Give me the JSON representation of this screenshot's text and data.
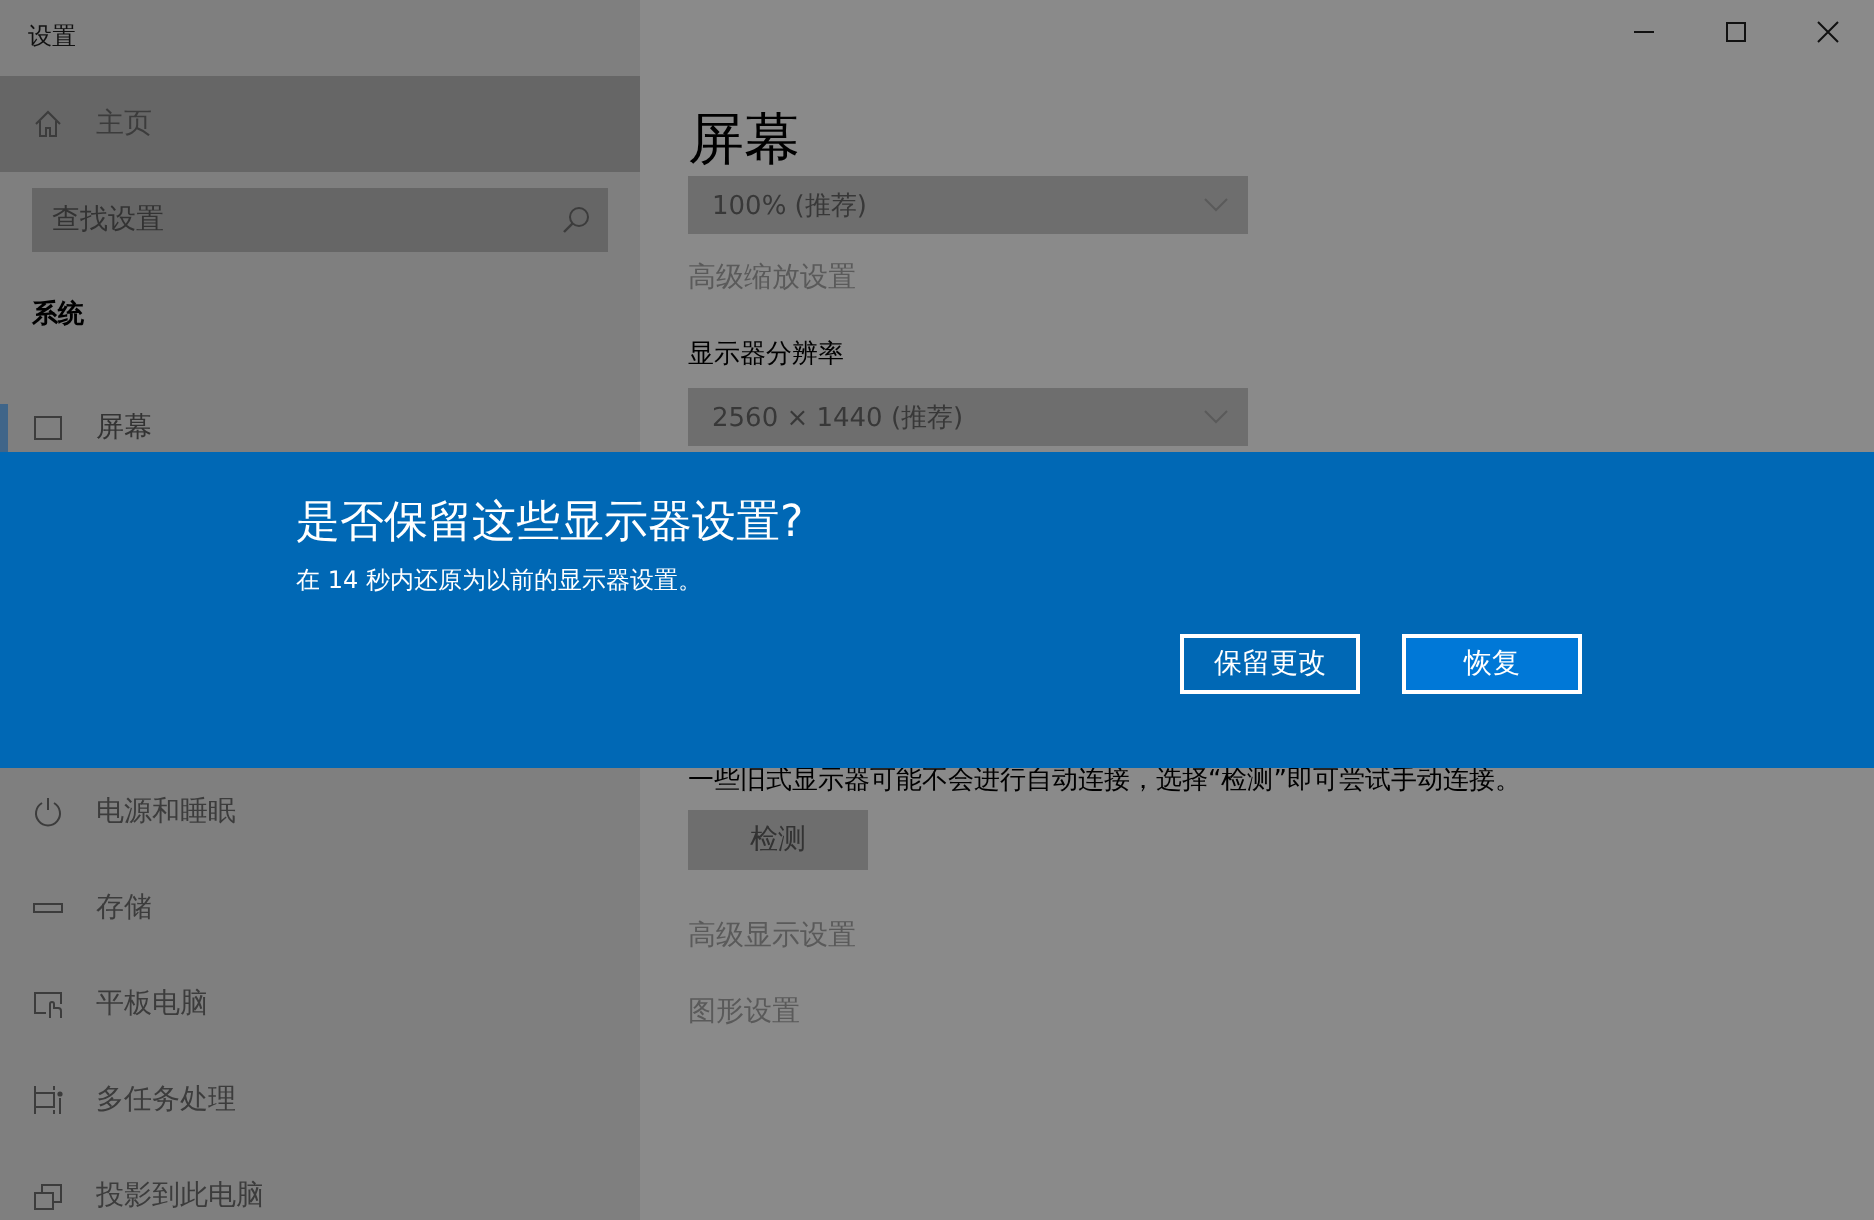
{
  "window": {
    "title": "设置"
  },
  "sidebar": {
    "home": "主页",
    "search": {
      "placeholder": "查找设置"
    },
    "section": "系统",
    "items": [
      {
        "label": "屏幕",
        "selected": true
      },
      {
        "label": "电源和睡眠",
        "selected": false
      },
      {
        "label": "存储",
        "selected": false
      },
      {
        "label": "平板电脑",
        "selected": false
      },
      {
        "label": "多任务处理",
        "selected": false
      },
      {
        "label": "投影到此电脑",
        "selected": false
      }
    ]
  },
  "content": {
    "title": "屏幕",
    "scale_dropdown": "100% (推荐)",
    "scale_link": "高级缩放设置",
    "resolution_label": "显示器分辨率",
    "resolution_dropdown": "2560 × 1440 (推荐)",
    "detect_note": "一些旧式显示器可能不会进行自动连接，选择“检测”即可尝试手动连接。",
    "detect_button": "检测",
    "links": [
      "高级显示设置",
      "图形设置"
    ]
  },
  "dialog": {
    "title": "是否保留这些显示器设置?",
    "message": "在 14 秒内还原为以前的显示器设置。",
    "buttons": [
      {
        "label": "保留更改",
        "kind": "outline"
      },
      {
        "label": "恢复",
        "kind": "primary"
      }
    ]
  }
}
